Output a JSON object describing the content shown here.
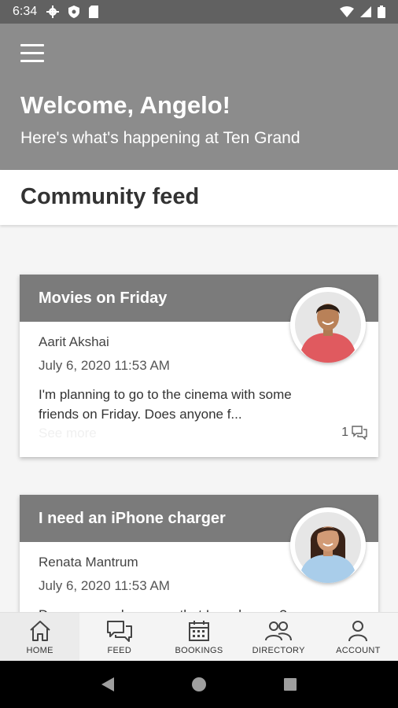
{
  "status_bar": {
    "time": "6:34"
  },
  "header": {
    "title": "Welcome, Angelo!",
    "subtitle": "Here's what's happening at Ten Grand"
  },
  "section": {
    "title": "Community feed"
  },
  "posts": [
    {
      "title": "Movies on Friday",
      "author": "Aarit Akshai",
      "date": "July 6, 2020 11:53 AM",
      "text": "I'm planning to go to the cinema with some friends on Friday. Does anyone f...",
      "see_more": "See more",
      "comment_count": "1"
    },
    {
      "title": "I need an iPhone charger",
      "author": "Renata Mantrum",
      "date": "July 6, 2020 11:53 AM",
      "text": "Does anyone have one that I can borrow?"
    }
  ],
  "tabs": [
    {
      "label": "HOME",
      "icon": "home-icon"
    },
    {
      "label": "FEED",
      "icon": "chat-icon"
    },
    {
      "label": "BOOKINGS",
      "icon": "calendar-icon"
    },
    {
      "label": "DIRECTORY",
      "icon": "people-icon"
    },
    {
      "label": "ACCOUNT",
      "icon": "person-icon"
    }
  ],
  "colors": {
    "status_bar": "#616161",
    "header_bg": "#8c8c8c",
    "card_header_bg": "#7b7b7b",
    "page_bg": "#f5f5f5"
  }
}
